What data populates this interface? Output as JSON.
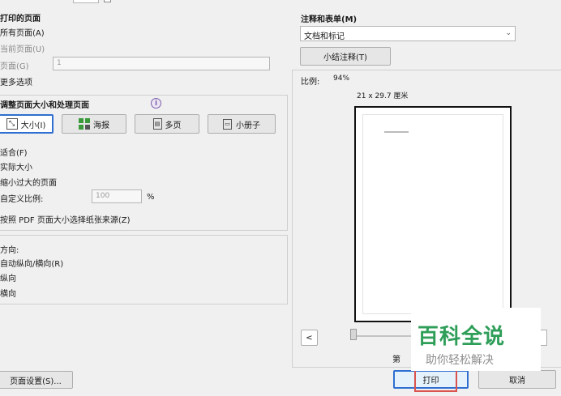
{
  "pages_section": {
    "title": "打印的页面",
    "all_pages": "所有页面(A)",
    "current_page": "当前页面(U)",
    "pages_label": "页面(G)",
    "pages_value": "1",
    "more_options": "更多选项"
  },
  "sizing_section": {
    "title": "调整页面大小和处理页面",
    "buttons": {
      "size": "大小(I)",
      "poster": "海报",
      "multiple": "多页",
      "booklet": "小册子"
    },
    "fit": "适合(F)",
    "actual_size": "实际大小",
    "shrink": "缩小过大的页面",
    "custom_scale": "自定义比例:",
    "custom_scale_value": "100",
    "percent": "%",
    "paper_source": "按照 PDF 页面大小选择纸张来源(Z)"
  },
  "orientation_section": {
    "title": "方向:",
    "auto": "自动纵向/横向(R)",
    "portrait": "纵向",
    "landscape": "横向"
  },
  "comments_section": {
    "title": "注释和表单(M)",
    "selected": "文档和标记",
    "summarize_button": "小结注释(T)"
  },
  "preview": {
    "scale_label": "比例:",
    "scale_value": "94%",
    "page_size": "21 x 29.7 厘米",
    "prev_button": "<",
    "page_label": "第"
  },
  "footer": {
    "page_setup": "页面设置(S)...",
    "print": "打印",
    "cancel": "取消"
  },
  "watermark": {
    "title": "百科全说",
    "subtitle": "助你轻松解决"
  },
  "colors": {
    "print_highlight": "#d9534f",
    "watermark_green": "#2e9e58",
    "selected_border": "#2f6fd1"
  }
}
